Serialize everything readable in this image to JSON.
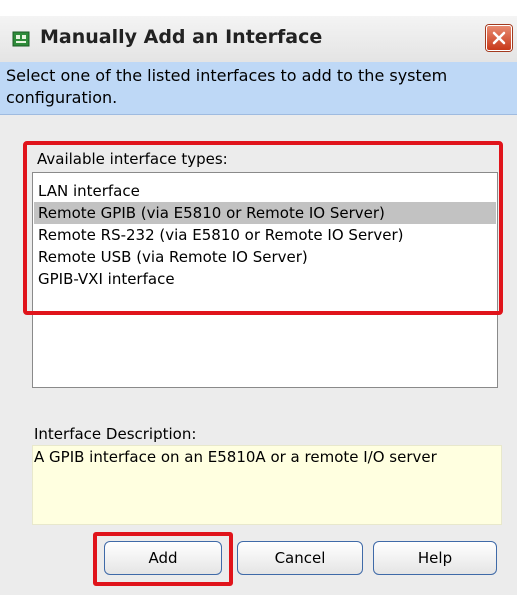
{
  "window": {
    "title": "Manually Add an Interface",
    "icon": "interface-app-icon",
    "close_icon": "close-icon"
  },
  "instruction": "Select one of the listed interfaces to add to the system configuration.",
  "available": {
    "label": "Available interface types:",
    "items": [
      "LAN interface",
      "Remote GPIB (via E5810 or Remote IO Server)",
      "Remote RS-232 (via E5810 or Remote IO Server)",
      "Remote USB (via Remote IO Server)",
      "GPIB-VXI interface"
    ],
    "selected_index": 1
  },
  "description": {
    "label": "Interface Description:",
    "text": "A GPIB interface on an E5810A or a remote I/O server"
  },
  "buttons": {
    "add": "Add",
    "cancel": "Cancel",
    "help": "Help"
  },
  "colors": {
    "annotation_red": "#e0141b",
    "instruction_bg": "#bed8f6",
    "description_bg": "#ffffe0",
    "selection_bg": "#c2c2c2"
  }
}
